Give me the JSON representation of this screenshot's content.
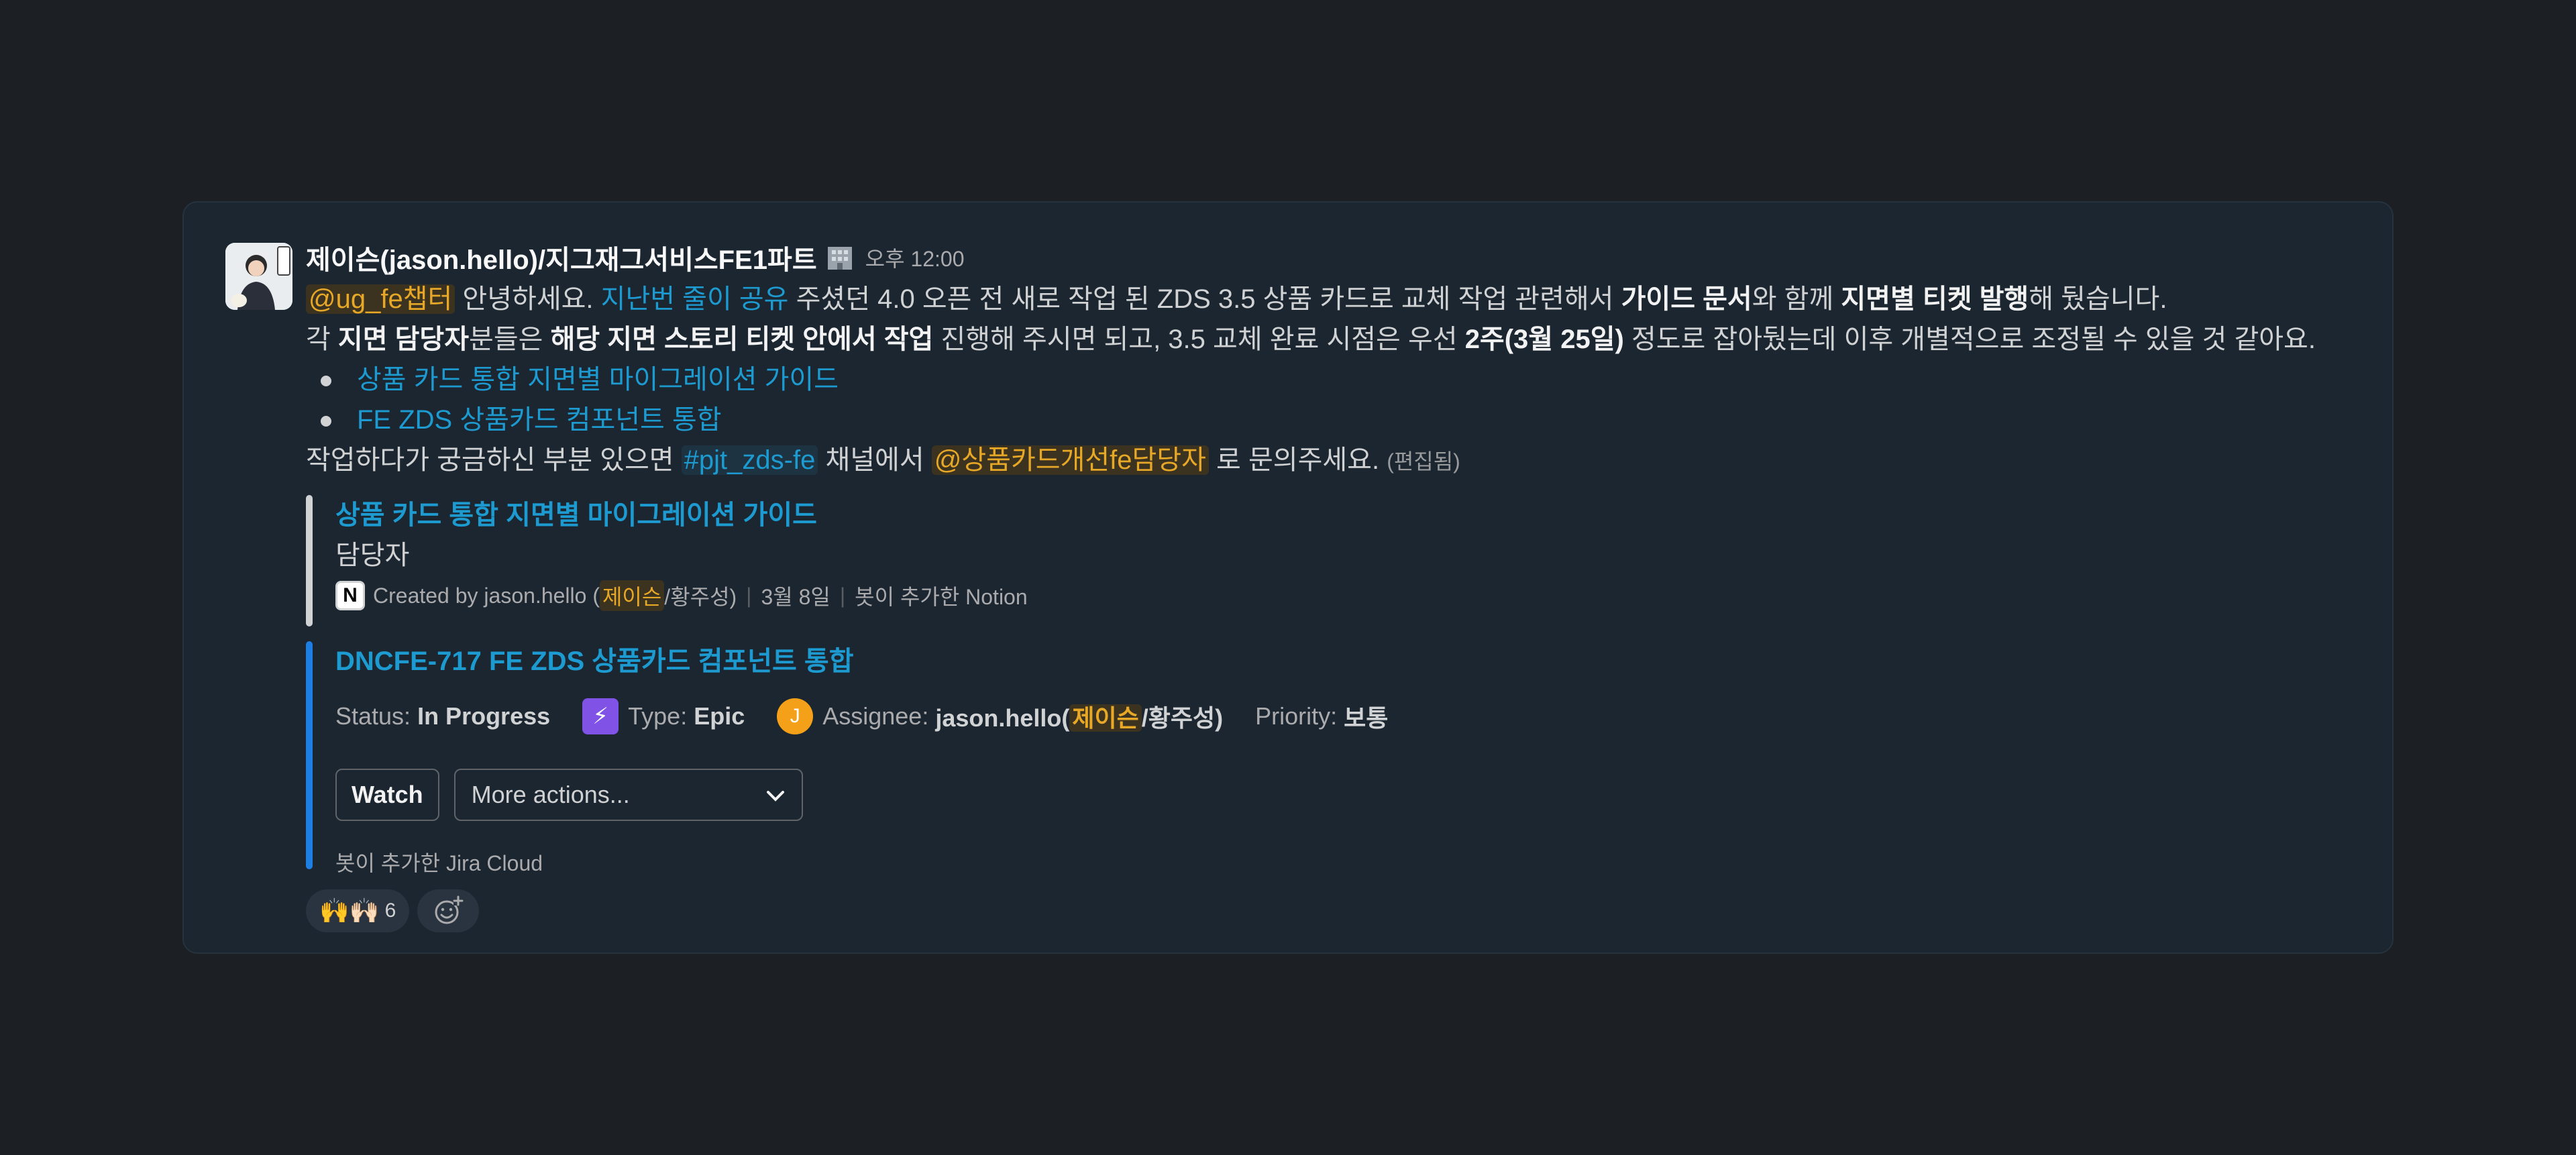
{
  "message": {
    "sender": "제이슨(jason.hello)/지그재그서비스FE1파트",
    "status_icon": "building-icon",
    "time": "오후 12:00",
    "line1": {
      "mention": "@ug_fe챕터",
      "t1": " 안녕하세요. ",
      "link": "지난번 줄이 공유",
      "t2": " 주셨던 4.0 오픈 전 새로 작업 된 ZDS 3.5 상품 카드로 교체 작업 관련해서 ",
      "b1": "가이드 문서",
      "t3": "와 함께 ",
      "b2": "지면별 티켓 발행",
      "t4": "해 뒀습니다."
    },
    "line2": {
      "t1": "각 ",
      "b1": "지면 담당자",
      "t2": "분들은 ",
      "b2": "해당 지면 스토리 티켓 안에서 작업",
      "t3": " 진행해 주시면 되고, 3.5 교체 완료 시점은 우선 ",
      "b3": "2주(3월 25일)",
      "t4": " 정도로 잡아뒀는데 이후 개별적으로 조정될 수 있을 것 같아요."
    },
    "bullets": [
      "상품 카드 통합 지면별 마이그레이션 가이드",
      "FE ZDS 상품카드 컴포넌트 통합"
    ],
    "line3": {
      "t1": "작업하다가 궁금하신 부분 있으면 ",
      "channel": "#pjt_zds-fe",
      "t2": " 채널에서 ",
      "mention": "@상품카드개선fe담당자",
      "t3": " 로 문의주세요. ",
      "edited": "(편집됨)"
    }
  },
  "notion_attachment": {
    "title": "상품 카드 통합 지면별 마이그레이션 가이드",
    "body": "담당자",
    "icon": "notion-icon",
    "created_prefix": "Created by jason.hello (",
    "created_highlight": "제이슨",
    "created_suffix": "/황주성)",
    "date": "3월 8일",
    "source": "봇이 추가한 Notion",
    "bar_color": "#d1d2d3"
  },
  "jira_attachment": {
    "title": "DNCFE-717 FE ZDS 상품카드 컴포넌트 통합",
    "status_label": "Status:",
    "status_value": "In Progress",
    "type_label": "Type:",
    "type_value": "Epic",
    "assignee_label": "Assignee:",
    "assignee_prefix": "jason.hello(",
    "assignee_highlight": "제이슨",
    "assignee_suffix": "/황주성)",
    "assignee_initial": "J",
    "priority_label": "Priority:",
    "priority_value": "보통",
    "watch_button": "Watch",
    "more_actions": "More actions...",
    "source": "봇이 추가한 Jira Cloud",
    "bar_color": "#1d7fe4"
  },
  "reactions": {
    "emoji": "🙌🙌🏻",
    "count": "6"
  }
}
